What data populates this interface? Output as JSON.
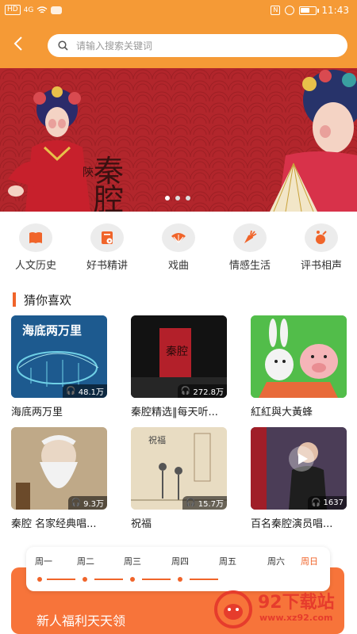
{
  "status": {
    "hd": "HD",
    "signal": "4G",
    "time": "11:43",
    "battery_level": 0.6
  },
  "search": {
    "placeholder": "请输入搜索关键词"
  },
  "banner": {
    "calligraphy_small": "陝",
    "calligraphy_large": "秦腔",
    "slide_count": 3,
    "active_slide": 1
  },
  "categories": [
    {
      "label": "人文历史",
      "icon": "book-icon"
    },
    {
      "label": "好书精讲",
      "icon": "book-play-icon"
    },
    {
      "label": "戏曲",
      "icon": "fan-icon"
    },
    {
      "label": "情感生活",
      "icon": "radish-icon"
    },
    {
      "label": "评书相声",
      "icon": "fruit-icon"
    }
  ],
  "section": {
    "title": "猜你喜欢"
  },
  "items": [
    {
      "title": "海底两万里",
      "plays": "48.1万",
      "cover_text": "海底两万里",
      "cover_color": "#1f6aa8"
    },
    {
      "title": "秦腔精选‖每天听...",
      "plays": "272.8万",
      "cover_text": "秦腔",
      "cover_color": "#1a1a1a"
    },
    {
      "title": "紅紅與大黃蜂",
      "plays": "",
      "cover_text": "",
      "cover_color": "#4ec04e"
    },
    {
      "title": "秦腔 名家经典唱...",
      "plays": "9.3万",
      "cover_text": "",
      "cover_color": "#c9b89a"
    },
    {
      "title": "祝福",
      "plays": "15.7万",
      "cover_text": "祝福",
      "cover_color": "#e6d8bd"
    },
    {
      "title": "百名秦腔演员唱...",
      "plays": "1637",
      "cover_text": "",
      "cover_color": "#5a4a66"
    }
  ],
  "week": {
    "days": [
      "周一",
      "周二",
      "周三",
      "周四",
      "周五",
      "周六",
      "周日"
    ],
    "active": "周日"
  },
  "promo": {
    "text": "新人福利天天领"
  },
  "watermark": {
    "brand": "92下载站",
    "url": "www.xz92.com"
  },
  "colors": {
    "header": "#f59a36",
    "accent": "#f0642a",
    "banner": "#b2262c"
  }
}
